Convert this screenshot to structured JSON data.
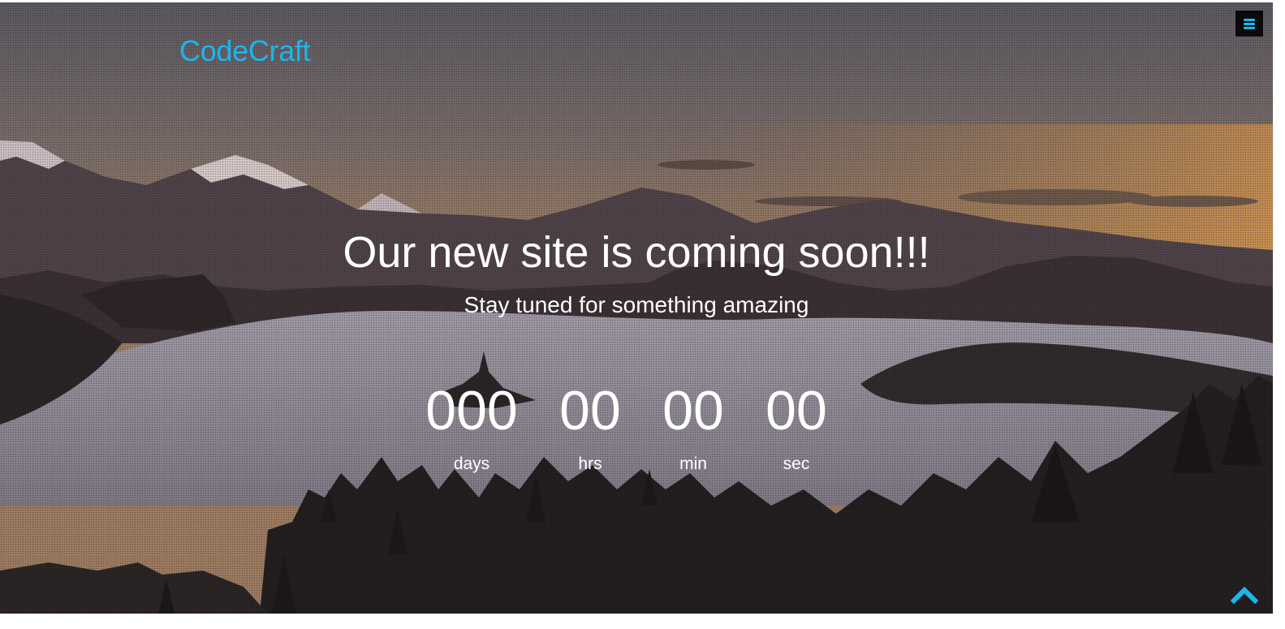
{
  "brand": {
    "name": "CodeCraft",
    "color": "#1cb5ee"
  },
  "header": {
    "menu_icon": "hamburger-menu-icon"
  },
  "hero": {
    "headline": "Our new site is coming soon!!!",
    "subline": "Stay tuned for something amazing"
  },
  "countdown": {
    "days": {
      "value": "000",
      "unit": "days"
    },
    "hours": {
      "value": "00",
      "unit": "hrs"
    },
    "minutes": {
      "value": "00",
      "unit": "min"
    },
    "seconds": {
      "value": "00",
      "unit": "sec"
    }
  },
  "footer": {
    "scroll_top_icon": "chevron-up-icon"
  }
}
